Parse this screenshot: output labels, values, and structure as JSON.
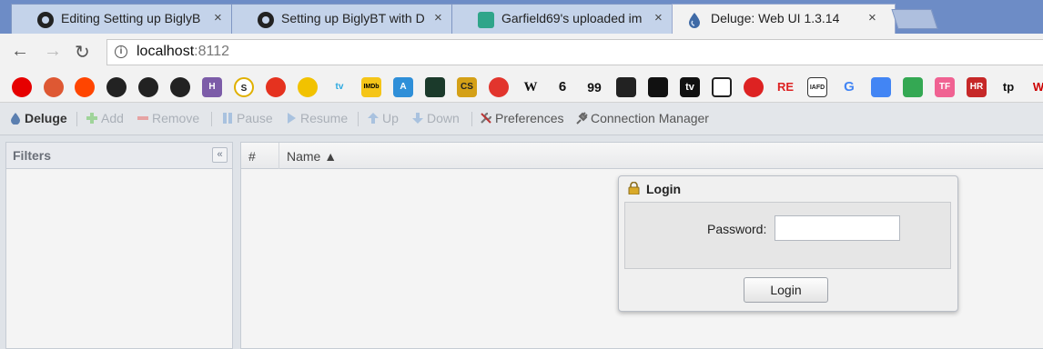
{
  "browser": {
    "tabs": [
      {
        "title": "Editing Setting up BiglyB",
        "favicon": "github-icon"
      },
      {
        "title": "Setting up BiglyBT with D",
        "favicon": "github-icon"
      },
      {
        "title": "Garfield69's uploaded im",
        "favicon": "imgur-icon"
      },
      {
        "title": "Deluge: Web UI 1.3.14",
        "favicon": "deluge-icon",
        "active": true
      }
    ],
    "close_glyph": "×",
    "url_host": "localhost",
    "url_port": ":8112",
    "bookmarks": [
      "vodafone",
      "duckduckgo",
      "reddit",
      "github",
      "github",
      "github",
      "H",
      "S",
      "tomato",
      "stop",
      "tv",
      "IMDb",
      "A",
      "terminal",
      "CS",
      "lifebuoy",
      "W",
      "6",
      "99",
      "robot",
      "X",
      "tv",
      "camera",
      "chevron",
      "RE",
      "IAFD",
      "G",
      "translate",
      "maps",
      "TF",
      "HR",
      "tp",
      "W"
    ]
  },
  "deluge": {
    "toolbar": {
      "deluge": "Deluge",
      "add": "Add",
      "remove": "Remove",
      "pause": "Pause",
      "resume": "Resume",
      "up": "Up",
      "down": "Down",
      "preferences": "Preferences",
      "connection_manager": "Connection Manager"
    },
    "filters_title": "Filters",
    "collapse_glyph": "«",
    "columns": {
      "num": "#",
      "name": "Name ▲"
    },
    "login": {
      "title": "Login",
      "password_label": "Password:",
      "password_value": "",
      "button": "Login"
    }
  }
}
